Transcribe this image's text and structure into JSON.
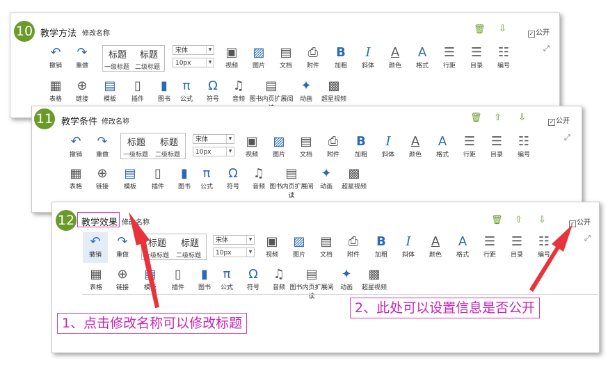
{
  "panels": [
    {
      "num": "10",
      "title": "教学方法",
      "rename": "修改名称",
      "public": "公开",
      "show_up": false
    },
    {
      "num": "11",
      "title": "教学条件",
      "rename": "修改名称",
      "public": "公开",
      "show_up": true
    },
    {
      "num": "12",
      "title": "教学效果",
      "rename": "修改名称",
      "public": "公开",
      "show_up": true
    }
  ],
  "toolbar": {
    "undo": "撤销",
    "redo": "重做",
    "style_h1": "标题",
    "style_h2": "标题",
    "style_h1_label": "一级标题",
    "style_h2_label": "二级标题",
    "font_family": "宋体",
    "font_size": "10px",
    "video": "视频",
    "image": "图片",
    "document": "文档",
    "attachment": "附件",
    "bold": "加粗",
    "italic": "斜体",
    "color": "颜色",
    "format": "格式",
    "line_height": "行距",
    "toc": "目录",
    "numbering": "编号",
    "table": "表格",
    "link": "链接",
    "template": "模板",
    "plugin": "插件",
    "book": "图书",
    "formula": "公式",
    "symbol": "符号",
    "audio": "音频",
    "book_page_read": "图书内页扩展阅读",
    "animation": "动画",
    "superstar_video": "超星视频"
  },
  "callouts": {
    "rename_tip": "1、点击修改名称可以修改标题",
    "public_tip": "2、此处可以设置信息是否公开"
  },
  "colors": {
    "badge": "#6a9a28",
    "annotation": "#d63ab0",
    "arrow": "#e8333a",
    "accent": "#2a6ab0"
  }
}
